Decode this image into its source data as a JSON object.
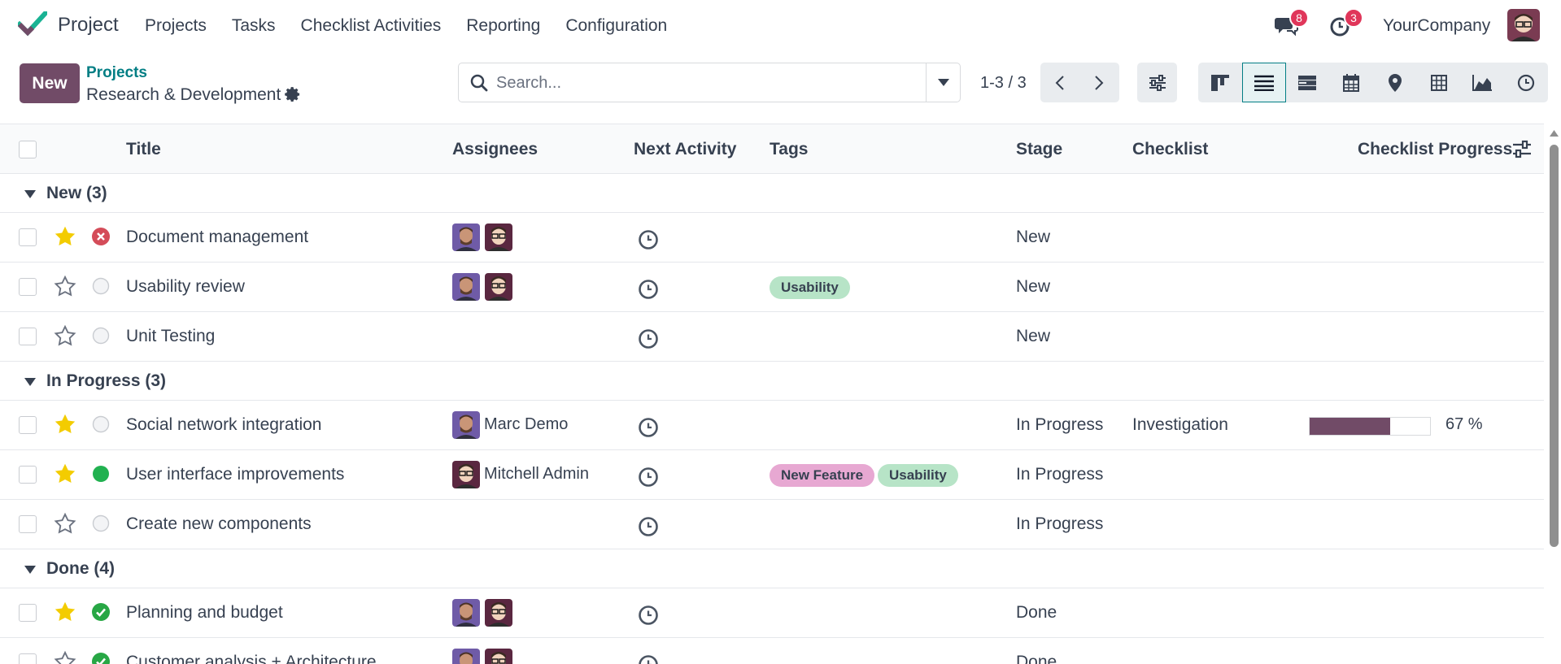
{
  "navbar": {
    "app_name": "Project",
    "menu": [
      "Projects",
      "Tasks",
      "Checklist Activities",
      "Reporting",
      "Configuration"
    ],
    "messages_count": "8",
    "activities_count": "3",
    "company": "YourCompany"
  },
  "control_panel": {
    "new_label": "New",
    "breadcrumb_parent": "Projects",
    "breadcrumb_current": "Research & Development",
    "search_placeholder": "Search...",
    "pager": "1-3 / 3",
    "views": [
      "kanban",
      "list",
      "gantt",
      "calendar",
      "map",
      "pivot",
      "graph",
      "activity"
    ],
    "active_view": "list"
  },
  "list": {
    "columns": {
      "title": "Title",
      "assignees": "Assignees",
      "next_activity": "Next Activity",
      "tags": "Tags",
      "stage": "Stage",
      "checklist": "Checklist",
      "checklist_progress": "Checklist Progress"
    },
    "groups": [
      {
        "label": "New (3)"
      },
      {
        "label": "In Progress (3)"
      },
      {
        "label": "Done (4)"
      }
    ],
    "rows": [
      {
        "title": "Document management",
        "starred": true,
        "state": "blocked",
        "assignees": [
          "marc",
          "mitchell"
        ],
        "assignee_name": "",
        "tags": [],
        "stage": "New",
        "checklist": "",
        "progress_text": "",
        "progress": null
      },
      {
        "title": "Usability review",
        "starred": false,
        "state": "normal",
        "assignees": [
          "marc",
          "mitchell"
        ],
        "assignee_name": "",
        "tags": [
          "Usability"
        ],
        "stage": "New",
        "checklist": "",
        "progress_text": "",
        "progress": null
      },
      {
        "title": "Unit Testing",
        "starred": false,
        "state": "normal",
        "assignees": [],
        "assignee_name": "",
        "tags": [],
        "stage": "New",
        "checklist": "",
        "progress_text": "",
        "progress": null
      },
      {
        "title": "Social network integration",
        "starred": true,
        "state": "normal",
        "assignees": [
          "marc"
        ],
        "assignee_name": "Marc Demo",
        "tags": [],
        "stage": "In Progress",
        "checklist": "Investigation",
        "progress_text": "67 %",
        "progress": 0.67
      },
      {
        "title": "User interface improvements",
        "starred": true,
        "state": "ready",
        "assignees": [
          "mitchell"
        ],
        "assignee_name": "Mitchell Admin",
        "tags": [
          "New Feature",
          "Usability"
        ],
        "stage": "In Progress",
        "checklist": "",
        "progress_text": "",
        "progress": null
      },
      {
        "title": "Create new components",
        "starred": false,
        "state": "normal",
        "assignees": [],
        "assignee_name": "",
        "tags": [],
        "stage": "In Progress",
        "checklist": "",
        "progress_text": "",
        "progress": null
      },
      {
        "title": "Planning and budget",
        "starred": true,
        "state": "done",
        "assignees": [
          "marc",
          "mitchell"
        ],
        "assignee_name": "",
        "tags": [],
        "stage": "Done",
        "checklist": "",
        "progress_text": "",
        "progress": null
      },
      {
        "title": "Customer analysis + Architecture",
        "starred": false,
        "state": "done",
        "assignees": [
          "marc",
          "mitchell"
        ],
        "assignee_name": "",
        "tags": [],
        "stage": "Done",
        "checklist": "",
        "progress_text": "",
        "progress": null
      }
    ]
  },
  "colors": {
    "brand": "#714b67",
    "link": "#017e84",
    "star": "#f3cc00",
    "blocked": "#d44c59",
    "ready": "#21b150",
    "done": "#28a745",
    "tag_usability": "#b7e4c7",
    "tag_new_feature": "#e7a8d2",
    "badge": "#e0365a"
  }
}
